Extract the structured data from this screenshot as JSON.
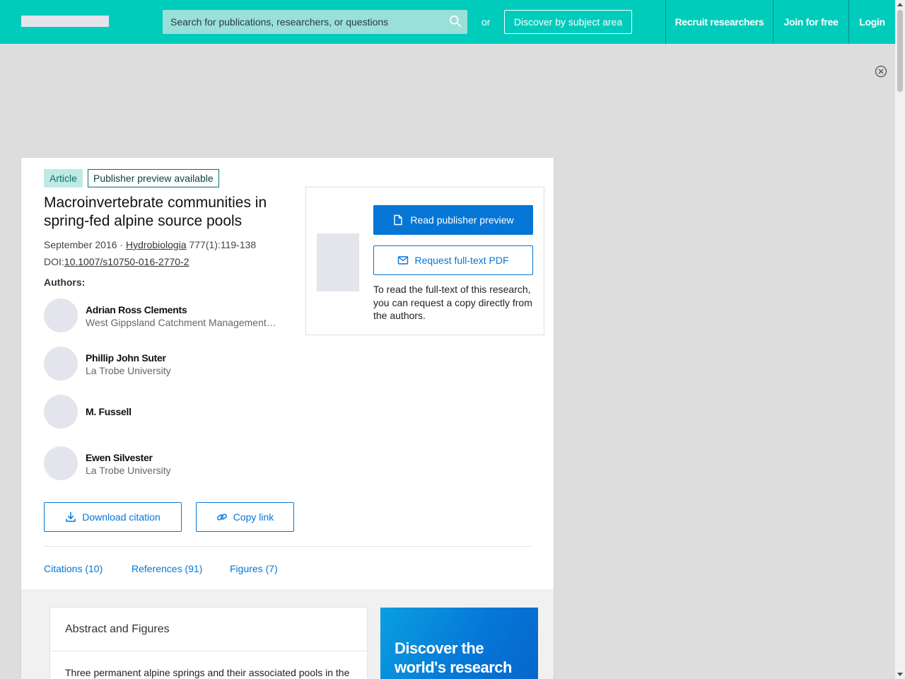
{
  "header": {
    "search_placeholder": "Search for publications, researchers, or questions",
    "or_text": "or",
    "discover_label": "Discover by subject area",
    "nav": {
      "recruit": "Recruit researchers",
      "join": "Join for free",
      "login": "Login"
    }
  },
  "article": {
    "badge_type": "Article",
    "badge_preview": "Publisher preview available",
    "title": "Macroinvertebrate communities in spring-fed alpine source pools",
    "date": "September 2016",
    "separator": " · ",
    "journal": "Hydrobiologia",
    "volume": " 777(1):119-138",
    "doi_label": "DOI:",
    "doi": "10.1007/s10750-016-2770-2",
    "authors_label": "Authors:",
    "authors": [
      {
        "name": "Adrian Ross Clements",
        "affiliation": "West Gippsland Catchment Management Authority"
      },
      {
        "name": "Phillip John Suter",
        "affiliation": "La Trobe University"
      },
      {
        "name": "M. Fussell",
        "affiliation": ""
      },
      {
        "name": "Ewen Silvester",
        "affiliation": "La Trobe University"
      }
    ],
    "download_citation": "Download citation",
    "copy_link": "Copy link",
    "tabs": {
      "citations": "Citations (10)",
      "references": "References (91)",
      "figures": "Figures (7)"
    }
  },
  "access": {
    "read_preview": "Read publisher preview",
    "request_pdf": "Request full-text PDF",
    "note": "To read the full-text of this research, you can request a copy directly from the authors."
  },
  "abstract": {
    "heading": "Abstract and Figures",
    "text": "Three permanent alpine springs and their associated pools in the"
  },
  "promo": {
    "text": "Discover the world's research"
  },
  "colors": {
    "header_bg": "#00ccbb",
    "primary": "#0576d6",
    "badge_bg": "#bfe9e4"
  }
}
